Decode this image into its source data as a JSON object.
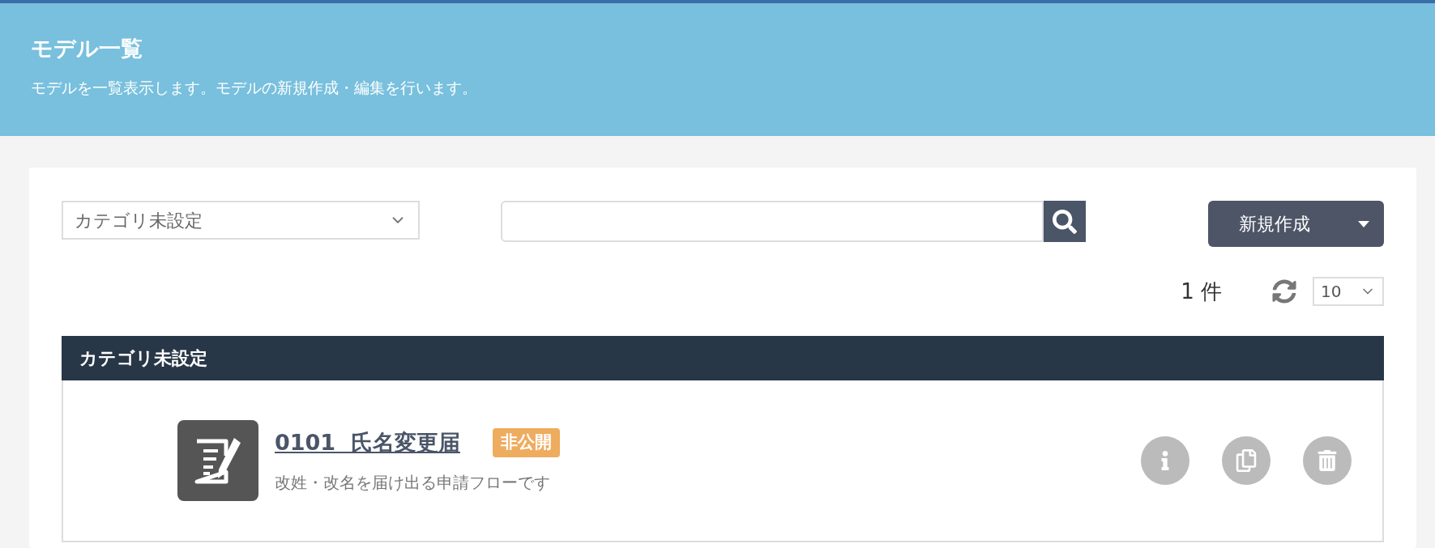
{
  "header": {
    "title": "モデル一覧",
    "description": "モデルを一覧表示します。モデルの新規作成・編集を行います。"
  },
  "toolbar": {
    "category_select": {
      "value": "カテゴリ未設定"
    },
    "new_button": {
      "label": "新規作成"
    }
  },
  "list_info": {
    "count": "1 件",
    "page_size": "10"
  },
  "groups": [
    {
      "title": "カテゴリ未設定",
      "models": [
        {
          "title": "0101  氏名変更届",
          "description": "改姓・改名を届け出る申請フローです",
          "badge": {
            "label": "非公開",
            "color": "#eeac5f"
          }
        }
      ]
    }
  ]
}
